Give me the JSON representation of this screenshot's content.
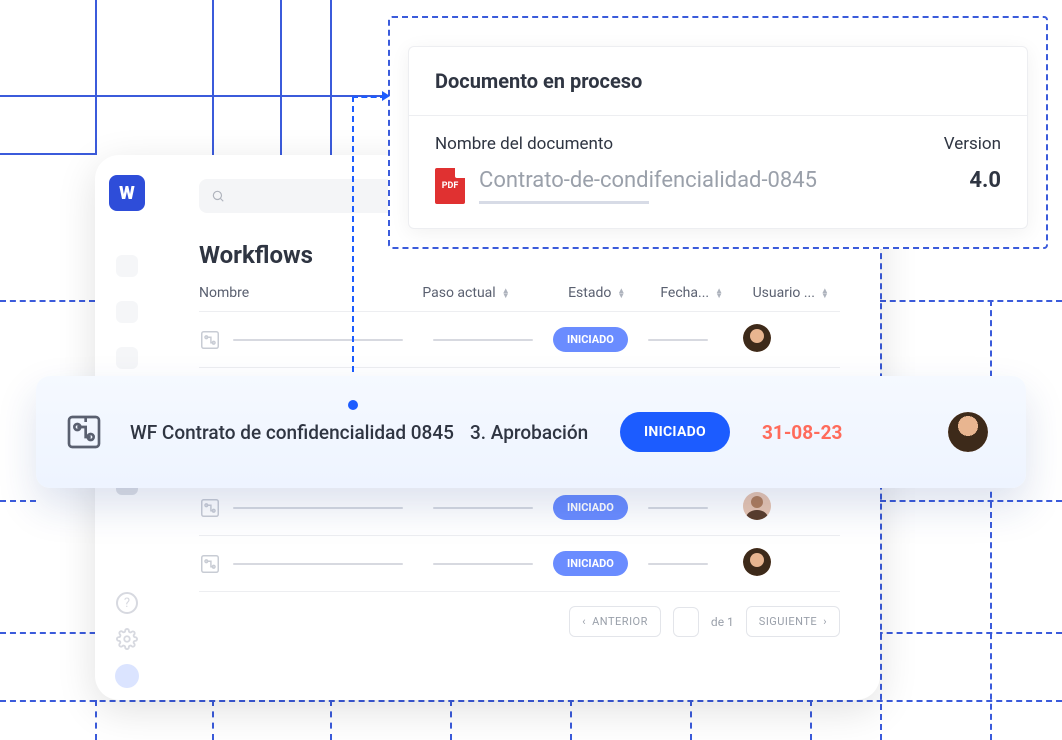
{
  "accent_color": "#1c5cff",
  "popover": {
    "title": "Documento en proceso",
    "name_label": "Nombre del documento",
    "version_label": "Version",
    "file_type": "PDF",
    "file_name": "Contrato-de-condifencialidad-0845",
    "version": "4.0"
  },
  "page": {
    "title": "Workflows",
    "columns": {
      "name": "Nombre",
      "step": "Paso actual",
      "status": "Estado",
      "date": "Fecha...",
      "user": "Usuario ..."
    },
    "status_label": "INICIADO",
    "pagination": {
      "prev": "ANTERIOR",
      "of": "de 1",
      "next": "SIGUIENTE"
    }
  },
  "highlight": {
    "name": "WF Contrato de confidencialidad 0845",
    "step": "3. Aprobación",
    "status": "INICIADO",
    "date": "31-08-23"
  }
}
